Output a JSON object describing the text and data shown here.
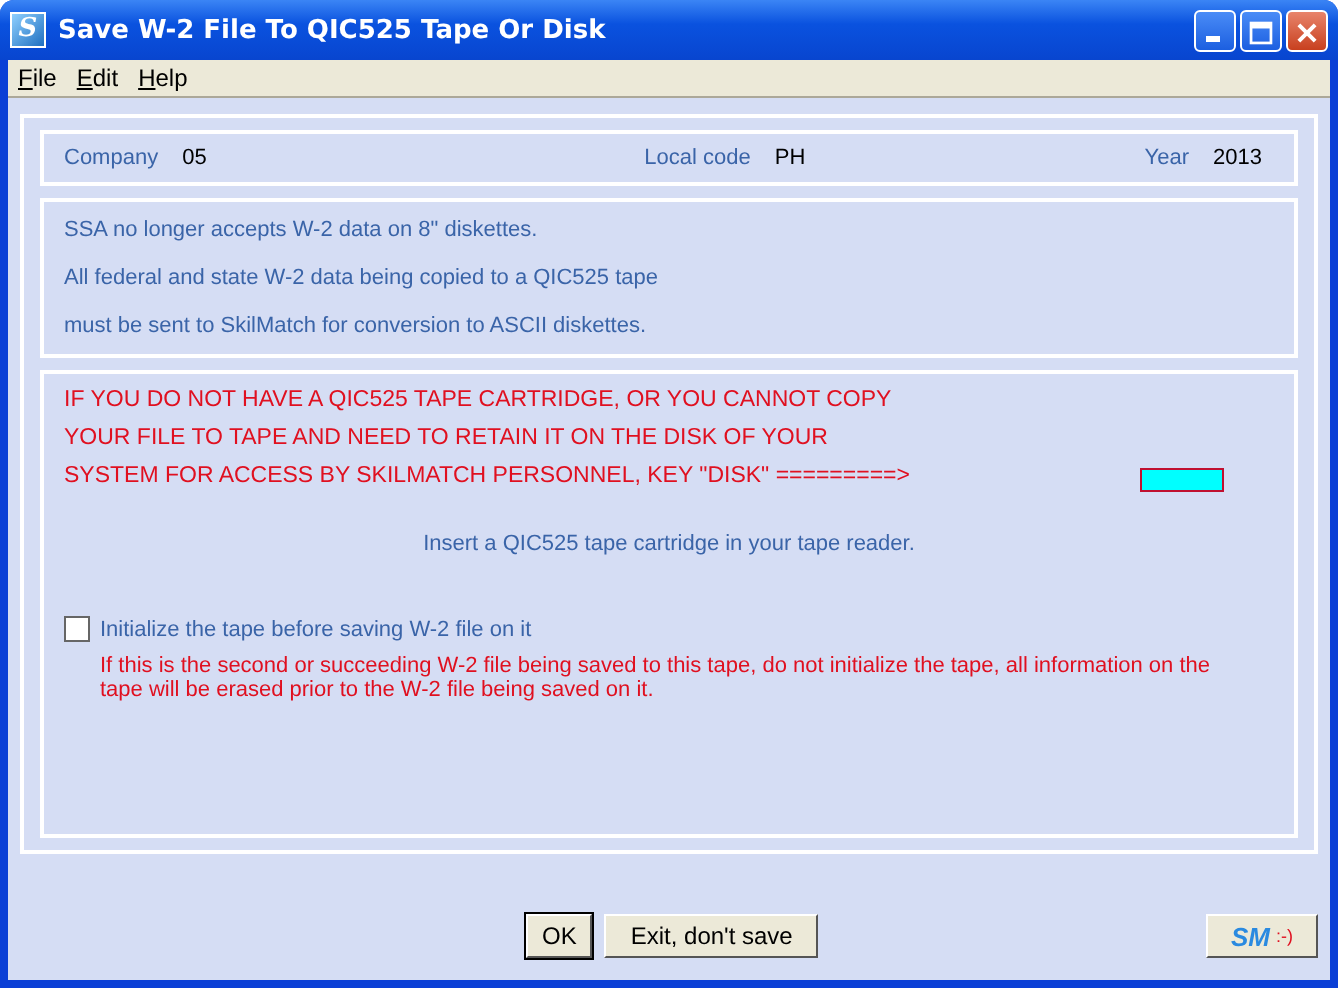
{
  "window": {
    "title": "Save W-2 File To QIC525 Tape Or Disk",
    "icon_letter": "S"
  },
  "menu": [
    {
      "label": "File"
    },
    {
      "label": "Edit"
    },
    {
      "label": "Help"
    }
  ],
  "header": [
    {
      "label": "Company",
      "value": "05"
    },
    {
      "label": "Local code",
      "value": "PH"
    },
    {
      "label": "Year",
      "value": "2013"
    }
  ],
  "info": [
    "SSA no longer accepts W-2 data on 8\" diskettes.",
    "All federal and state W-2 data being copied to a QIC525 tape",
    "must be sent to SkilMatch for conversion to ASCII diskettes."
  ],
  "warning": [
    "IF YOU DO NOT HAVE A QIC525 TAPE CARTRIDGE, OR YOU CANNOT COPY",
    "YOUR FILE TO TAPE AND NEED TO RETAIN IT ON THE DISK OF YOUR",
    "SYSTEM FOR ACCESS BY SKILMATCH PERSONNEL, KEY \"DISK\" =========>"
  ],
  "instruction": "Insert a QIC525 tape cartridge in your tape reader.",
  "initialize": {
    "label": "Initialize the tape before saving W-2 file on it",
    "checked": false,
    "note": "If this is the second or succeeding W-2 file being saved to this tape, do not initialize the tape, all information on the tape will be erased prior to the W-2 file being saved on it."
  },
  "buttons": [
    "OK",
    "Exit, don't save"
  ],
  "logo_button": {
    "mark": "SM",
    "smiley": ":-)"
  }
}
